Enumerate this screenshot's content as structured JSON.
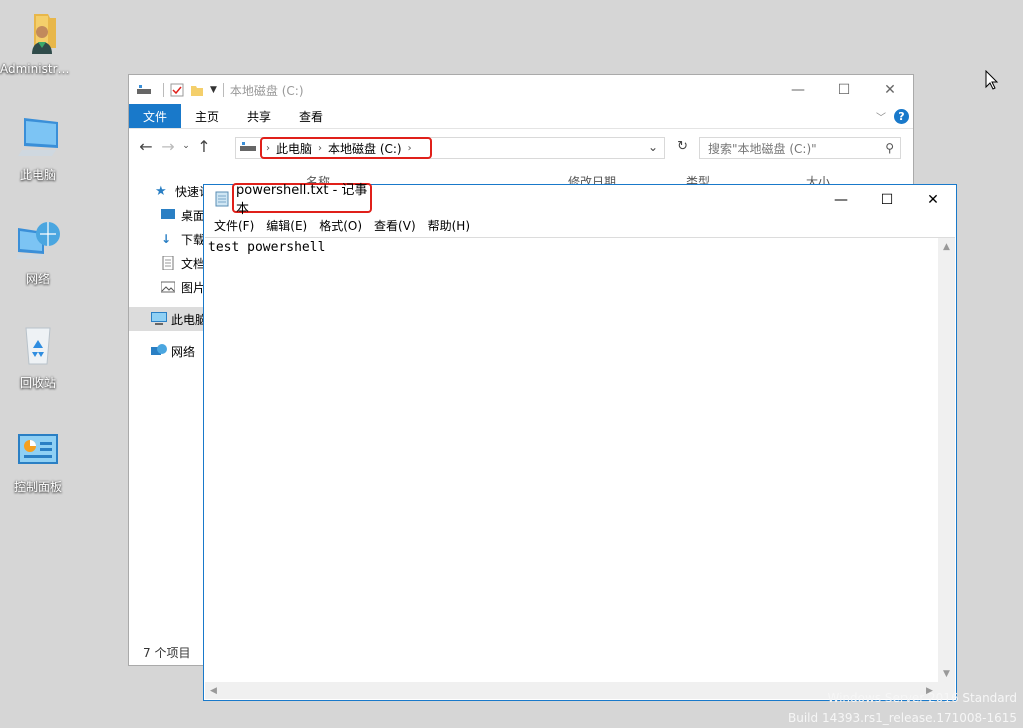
{
  "desktop": {
    "icons": [
      {
        "label": "Administra...",
        "icon": "user-folder-icon"
      },
      {
        "label": "此电脑",
        "icon": "computer-icon"
      },
      {
        "label": "网络",
        "icon": "network-icon"
      },
      {
        "label": "回收站",
        "icon": "recycle-bin-icon"
      },
      {
        "label": "控制面板",
        "icon": "control-panel-icon"
      }
    ],
    "watermark_line1": "Windows Server 2016 Standard",
    "watermark_line2": "Build 14393.rs1_release.171008-1615"
  },
  "explorer": {
    "title": "本地磁盘 (C:)",
    "ribbon_tabs": [
      "文件",
      "主页",
      "共享",
      "查看"
    ],
    "breadcrumb": [
      "此电脑",
      "本地磁盘 (C:)"
    ],
    "search_placeholder": "搜索\"本地磁盘 (C:)\"",
    "nav_items": [
      "快速访问",
      "桌面",
      "下载",
      "文档",
      "图片",
      "此电脑",
      "网络"
    ],
    "columns": [
      "名称",
      "修改日期",
      "类型",
      "大小"
    ],
    "status": "7 个项目"
  },
  "notepad": {
    "title": "powershell.txt - 记事本",
    "menu": [
      "文件(F)",
      "编辑(E)",
      "格式(O)",
      "查看(V)",
      "帮助(H)"
    ],
    "content": "test powershell"
  },
  "colors": {
    "accent": "#1979ca",
    "highlight": "#e0201a"
  }
}
